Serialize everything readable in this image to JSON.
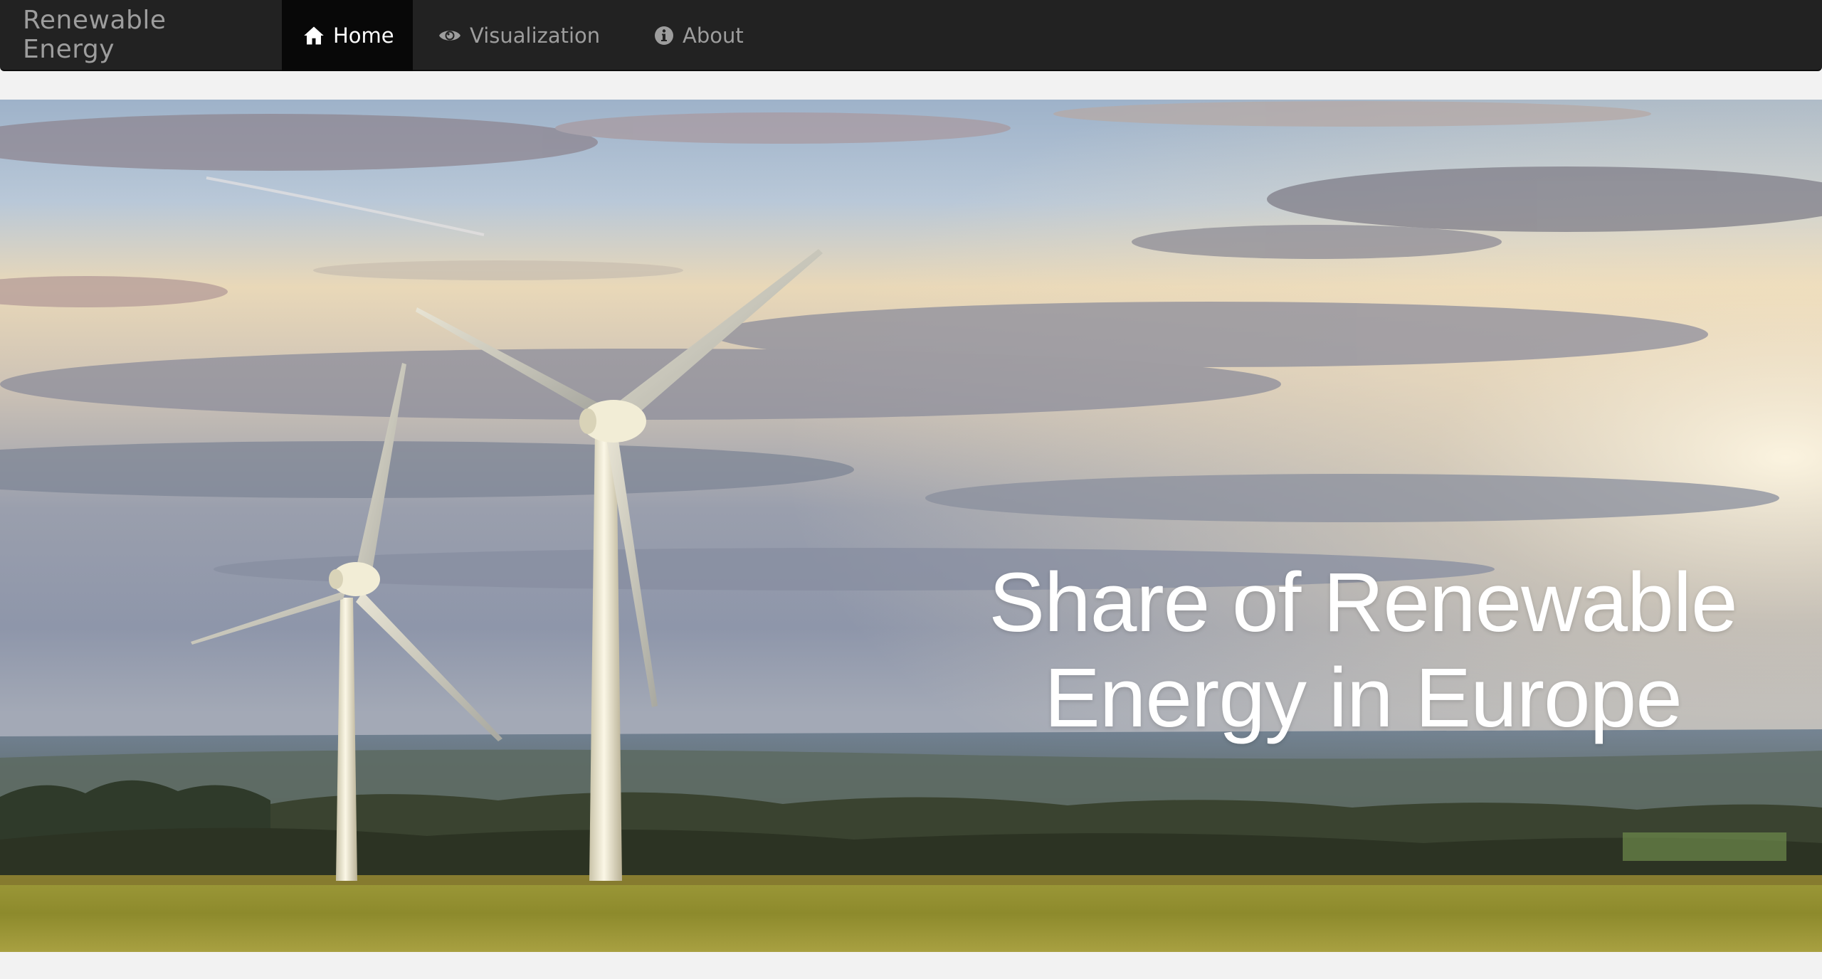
{
  "navbar": {
    "brand": "Renewable Energy",
    "items": [
      {
        "label": "Home",
        "icon": "home-icon",
        "active": true
      },
      {
        "label": "Visualization",
        "icon": "eye-icon",
        "active": false
      },
      {
        "label": "About",
        "icon": "info-icon",
        "active": false
      }
    ]
  },
  "hero": {
    "title": "Share of Renewable\nEnergy in Europe",
    "image": "wind-turbines-landscape"
  },
  "colors": {
    "navbar_bg": "#222222",
    "nav_active_bg": "#080808",
    "nav_text": "#9d9d9d",
    "nav_active_text": "#ffffff",
    "page_bg": "#f2f2f2"
  }
}
